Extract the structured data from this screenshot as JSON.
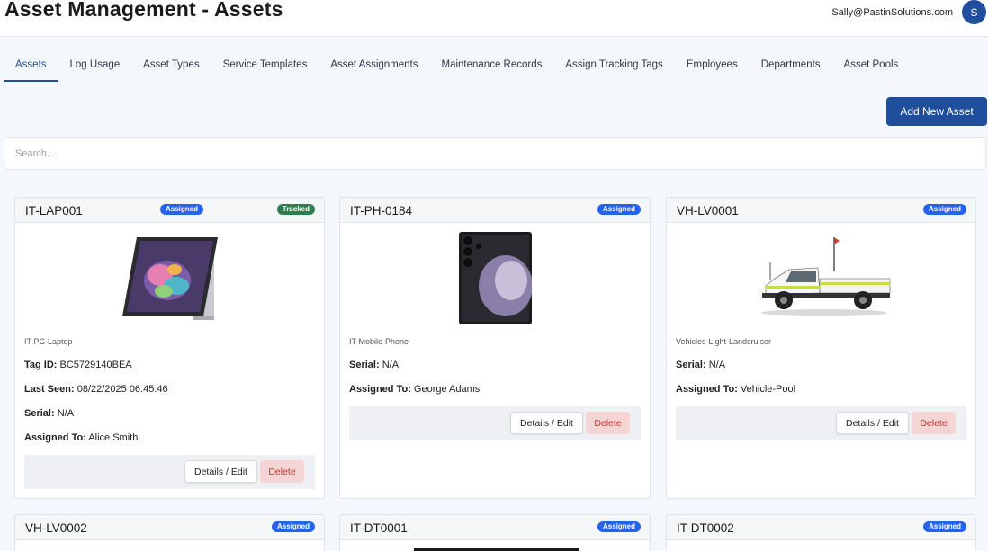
{
  "header": {
    "title": "Asset Management - Assets",
    "user_email": "Sally@PastinSolutions.com",
    "avatar_letter": "S"
  },
  "tabs": [
    {
      "label": "Assets",
      "active": true
    },
    {
      "label": "Log Usage"
    },
    {
      "label": "Asset Types"
    },
    {
      "label": "Service Templates"
    },
    {
      "label": "Asset Assignments"
    },
    {
      "label": "Maintenance Records"
    },
    {
      "label": "Assign Tracking Tags"
    },
    {
      "label": "Employees"
    },
    {
      "label": "Departments"
    },
    {
      "label": "Asset Pools"
    }
  ],
  "toolbar": {
    "add_label": "Add New Asset"
  },
  "search": {
    "placeholder": "Search..."
  },
  "labels": {
    "tag_id": "Tag ID:",
    "last_seen": "Last Seen:",
    "serial": "Serial:",
    "assigned_to": "Assigned To:",
    "details_edit": "Details / Edit",
    "delete": "Delete",
    "assigned_badge": "Assigned",
    "tracked_badge": "Tracked"
  },
  "cards": [
    {
      "id": "IT-LAP001",
      "type": "IT-PC-Laptop",
      "tag_id": "BC5729140BEA",
      "last_seen": "08/22/2025 06:45:46",
      "serial": "N/A",
      "assigned_to": "Alice Smith",
      "tracked": true
    },
    {
      "id": "IT-PH-0184",
      "type": "IT-Mobile-Phone",
      "serial": "N/A",
      "assigned_to": "George Adams"
    },
    {
      "id": "VH-LV0001",
      "type": "Vehicles-Light-Landcruiser",
      "serial": "N/A",
      "assigned_to": "Vehicle-Pool"
    },
    {
      "id": "VH-LV0002"
    },
    {
      "id": "IT-DT0001"
    },
    {
      "id": "IT-DT0002"
    }
  ]
}
